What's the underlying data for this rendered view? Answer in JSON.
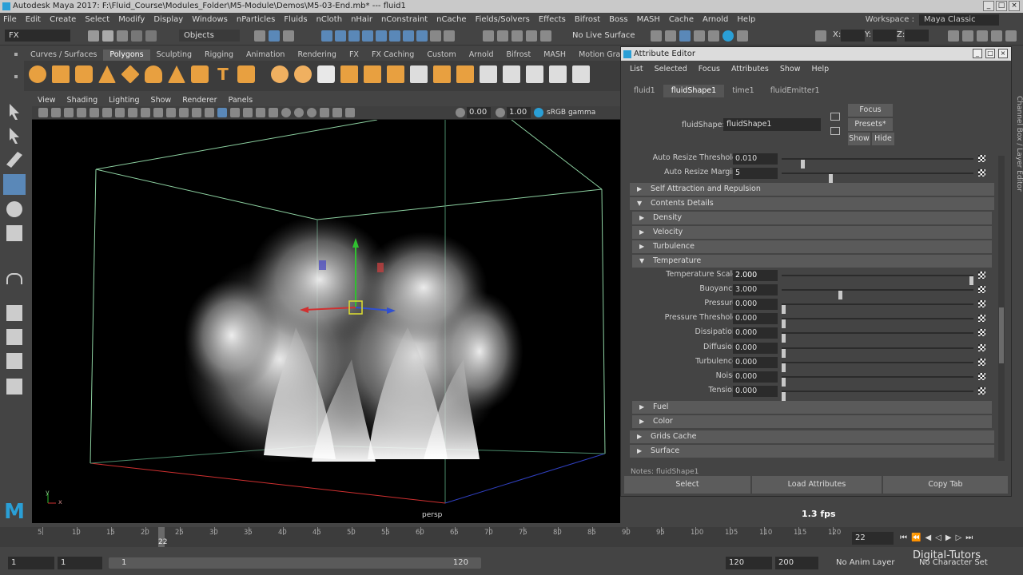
{
  "window": {
    "title": "Autodesk Maya 2017: F:\\Fluid_Course\\Modules_Folder\\M5-Module\\Demos\\M5-03-End.mb*  ---  fluid1",
    "min": "_",
    "max": "□",
    "close": "×"
  },
  "menubar": {
    "items": [
      "File",
      "Edit",
      "Create",
      "Select",
      "Modify",
      "Display",
      "Windows",
      "nParticles",
      "Fluids",
      "nCloth",
      "nHair",
      "nConstraint",
      "nCache",
      "Fields/Solvers",
      "Effects",
      "Bifrost",
      "Boss",
      "MASH",
      "Cache",
      "Arnold",
      "Help"
    ],
    "workspace_label": "Workspace :",
    "workspace_value": "Maya Classic"
  },
  "statusline": {
    "mode": "FX",
    "objects": "Objects",
    "live_surface": "No Live Surface",
    "x": "X:",
    "y": "Y:",
    "z": "Z:"
  },
  "shelf": {
    "tabs": [
      "Curves / Surfaces",
      "Polygons",
      "Sculpting",
      "Rigging",
      "Animation",
      "Rendering",
      "FX",
      "FX Caching",
      "Custom",
      "Arnold",
      "Bifrost",
      "MASH",
      "Motion Graphics"
    ],
    "active_tab": "Polygons"
  },
  "viewport": {
    "menu": [
      "View",
      "Shading",
      "Lighting",
      "Show",
      "Renderer",
      "Panels"
    ],
    "exposure": "0.00",
    "gamma": "1.00",
    "colorspace": "sRGB gamma",
    "camera_label": "persp",
    "fps": "1.3 fps",
    "axis_y": "y",
    "axis_x": "x"
  },
  "attribute_editor": {
    "title": "Attribute Editor",
    "menu": [
      "List",
      "Selected",
      "Focus",
      "Attributes",
      "Show",
      "Help"
    ],
    "tabs": [
      "fluid1",
      "fluidShape1",
      "time1",
      "fluidEmitter1"
    ],
    "active_tab": "fluidShape1",
    "node_label": "fluidShape:",
    "node_value": "fluidShape1",
    "focus_btn": "Focus",
    "presets_btn": "Presets*",
    "show_btn": "Show",
    "hide_btn": "Hide",
    "top_attrs": [
      {
        "label": "Auto Resize Threshold",
        "value": "0.010",
        "slider": 0.1
      },
      {
        "label": "Auto Resize Margin",
        "value": "5",
        "slider": 0.25
      }
    ],
    "sections": {
      "self_attraction": "Self Attraction and Repulsion",
      "contents_details": "Contents Details",
      "density": "Density",
      "velocity": "Velocity",
      "turbulence": "Turbulence",
      "temperature": "Temperature",
      "fuel": "Fuel",
      "color": "Color",
      "grids_cache": "Grids Cache",
      "surface": "Surface"
    },
    "temperature_attrs": [
      {
        "label": "Temperature Scale",
        "value": "2.000",
        "slider": 1.0
      },
      {
        "label": "Buoyancy",
        "value": "3.000",
        "slider": 0.3
      },
      {
        "label": "Pressure",
        "value": "0.000",
        "slider": 0.0
      },
      {
        "label": "Pressure Threshold",
        "value": "0.000",
        "slider": 0.0
      },
      {
        "label": "Dissipation",
        "value": "0.000",
        "slider": 0.0
      },
      {
        "label": "Diffusion",
        "value": "0.000",
        "slider": 0.0
      },
      {
        "label": "Turbulence",
        "value": "0.000",
        "slider": 0.0
      },
      {
        "label": "Noise",
        "value": "0.000",
        "slider": 0.0
      },
      {
        "label": "Tension",
        "value": "0.000",
        "slider": 0.0
      }
    ],
    "notes": "Notes: fluidShape1",
    "bottom_buttons": [
      "Select",
      "Load Attributes",
      "Copy Tab"
    ]
  },
  "side_tab": "Channel Box / Layer Editor",
  "timeline": {
    "ticks": [
      "5",
      "10",
      "15",
      "20",
      "25",
      "30",
      "35",
      "40",
      "45",
      "50",
      "55",
      "60",
      "65",
      "70",
      "75",
      "80",
      "85",
      "90",
      "95",
      "100",
      "105",
      "110",
      "115",
      "120"
    ],
    "current_frame": "22",
    "frame_field": "22"
  },
  "range": {
    "start": "1",
    "playback_start": "1",
    "range_start": "1",
    "range_end": "120",
    "playback_end": "120",
    "end": "200",
    "anim_layer": "No Anim Layer",
    "char_set": "No Character Set"
  },
  "watermark": "Digital-Tutors"
}
